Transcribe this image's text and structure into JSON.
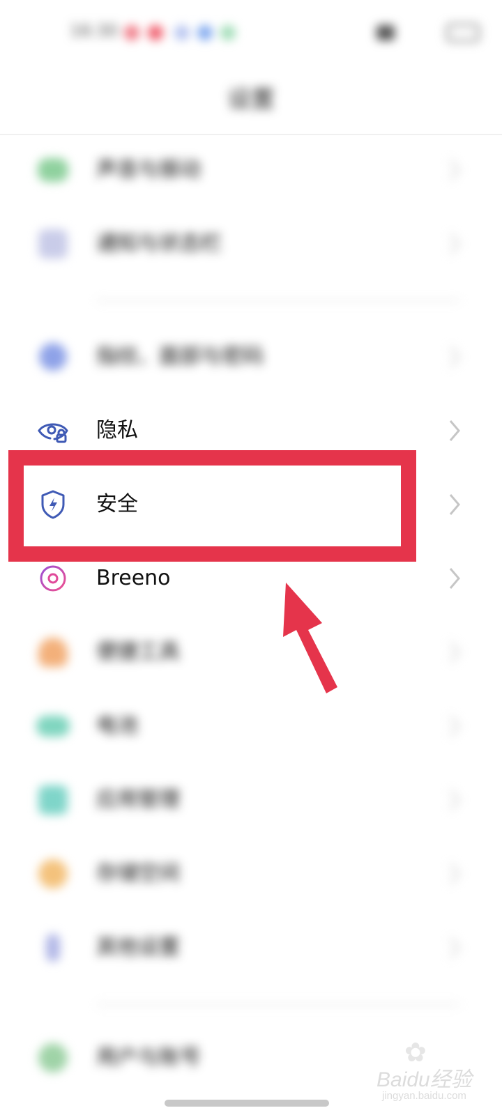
{
  "header": {
    "title": "设置"
  },
  "status_bar": {
    "time": "16:30"
  },
  "rows": [
    {
      "label": "声音与振动",
      "icon": "speaker-icon",
      "color": "#8fd19e",
      "blurred": true
    },
    {
      "label": "通知与状态栏",
      "icon": "notification-icon",
      "color": "#c9cce9",
      "blurred": true
    },
    {
      "label": "指纹、面部与密码",
      "icon": "lock-icon",
      "color": "#8ea2e8",
      "blurred": true
    },
    {
      "label": "隐私",
      "icon": "privacy-eye-icon",
      "color": "#3f5ab5",
      "blurred": false
    },
    {
      "label": "安全",
      "icon": "shield-icon",
      "color": "#3f5ab5",
      "blurred": false
    },
    {
      "label": "Breeno",
      "icon": "breeno-icon",
      "color": "#c84bb4",
      "blurred": false
    },
    {
      "label": "便捷工具",
      "icon": "tools-icon",
      "color": "#f3b07a",
      "blurred": true
    },
    {
      "label": "电池",
      "icon": "battery-icon",
      "color": "#7fd5bf",
      "blurred": true
    },
    {
      "label": "应用管理",
      "icon": "apps-icon",
      "color": "#7fd5c9",
      "blurred": true
    },
    {
      "label": "存储空间",
      "icon": "storage-icon",
      "color": "#f4c27c",
      "blurred": true
    },
    {
      "label": "其他设置",
      "icon": "settings-icon",
      "color": "#b0b6e6",
      "blurred": true
    },
    {
      "label": "用户与账号",
      "icon": "user-icon",
      "color": "#9fd3a7",
      "blurred": true
    }
  ],
  "annotation": {
    "highlight_color": "#e5344b",
    "highlighted_item": "安全"
  },
  "watermark": {
    "brand": "Baidu经验",
    "url": "jingyan.baidu.com"
  }
}
